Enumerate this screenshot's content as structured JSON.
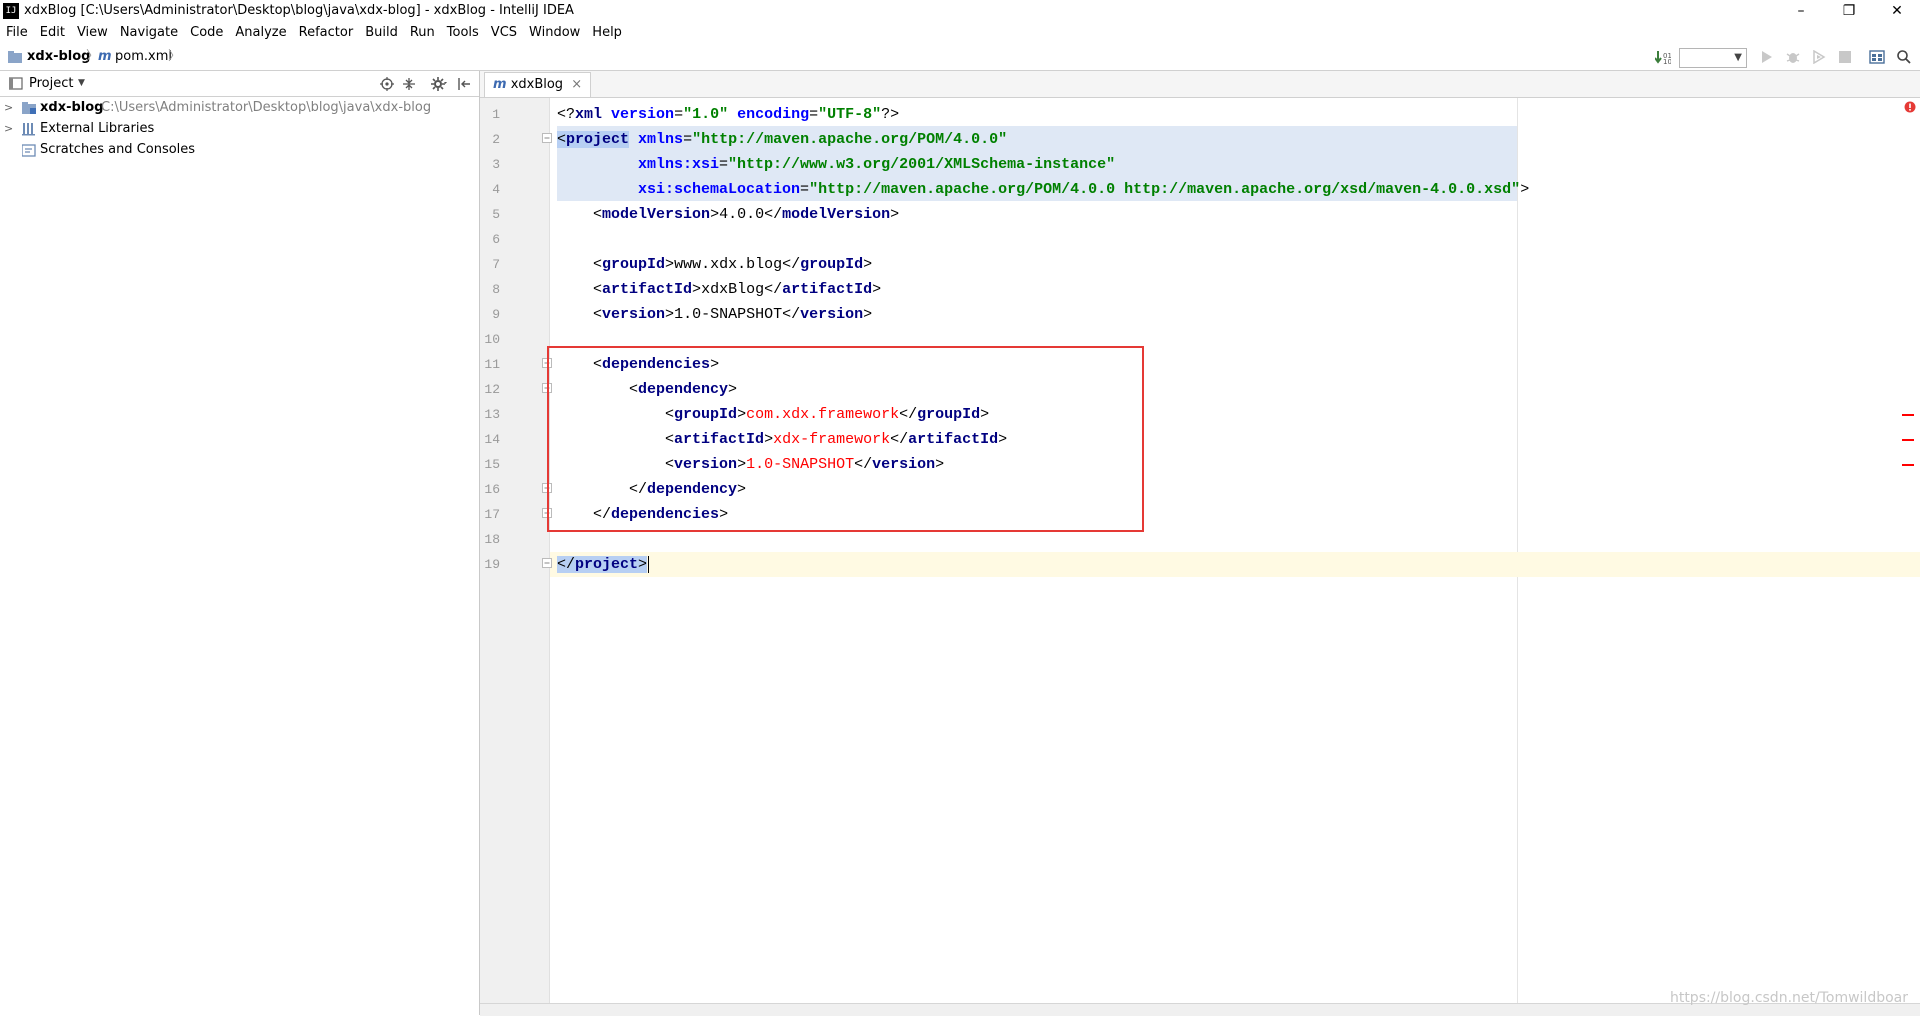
{
  "window": {
    "title": "xdxBlog [C:\\Users\\Administrator\\Desktop\\blog\\java\\xdx-blog] - xdxBlog - IntelliJ IDEA",
    "minimize": "–",
    "restore": "❐",
    "close": "✕"
  },
  "menu": [
    "File",
    "Edit",
    "View",
    "Navigate",
    "Code",
    "Analyze",
    "Refactor",
    "Build",
    "Run",
    "Tools",
    "VCS",
    "Window",
    "Help"
  ],
  "navbar": {
    "project": "xdx-blog",
    "file_icon": "m",
    "file": "pom.xml"
  },
  "project_panel": {
    "header": "Project",
    "tree": [
      {
        "name": "xdx-blog",
        "path": "C:\\Users\\Administrator\\Desktop\\blog\\java\\xdx-blog"
      },
      {
        "name": "External Libraries",
        "path": ""
      },
      {
        "name": "Scratches and Consoles",
        "path": ""
      }
    ]
  },
  "tab": {
    "icon": "m",
    "label": "xdxBlog",
    "close": "×"
  },
  "editor": {
    "line_numbers": [
      "1",
      "2",
      "3",
      "4",
      "5",
      "6",
      "7",
      "8",
      "9",
      "10",
      "11",
      "12",
      "13",
      "14",
      "15",
      "16",
      "17",
      "18",
      "19"
    ],
    "tokens": {
      "l1_open": "<?",
      "l1_tag": "xml",
      "l1_a1": "version",
      "l1_eq1": "=",
      "l1_v1": "\"1.0\"",
      "l1_a2": "encoding",
      "l1_eq2": "=",
      "l1_v2": "\"UTF-8\"",
      "l1_close": "?>",
      "l2_lt": "<",
      "l2_tag": "project",
      "l2_a1": "xmlns",
      "l2_eq1": "=",
      "l2_v1": "\"http://maven.apache.org/POM/4.0.0\"",
      "l3_a1": "xmlns:xsi",
      "l3_eq1": "=",
      "l3_v1": "\"http://www.w3.org/2001/XMLSchema-instance\"",
      "l4_a1": "xsi:schemaLocation",
      "l4_eq1": "=",
      "l4_v1": "\"http://maven.apache.org/POM/4.0.0 http://maven.apache.org/xsd/maven-4.0.0.xsd\"",
      "l4_gt": ">",
      "lt": "<",
      "gt": ">",
      "lts": "</",
      "modelVersion": "modelVersion",
      "modelVersion_val": "4.0.0",
      "groupId": "groupId",
      "groupId_val": "www.xdx.blog",
      "artifactId": "artifactId",
      "artifactId_val": "xdxBlog",
      "version": "version",
      "version_val": "1.0-SNAPSHOT",
      "dependencies": "dependencies",
      "dependency": "dependency",
      "dep_groupId_val": "com.xdx.framework",
      "dep_artifactId_val": "xdx-framework",
      "dep_version_val": "1.0-SNAPSHOT",
      "project": "project"
    }
  },
  "watermark": "https://blog.csdn.net/Tomwildboar",
  "colors": {
    "tag": "#000080",
    "attribute": "#0000ff",
    "string": "#008000",
    "error": "#ff0000",
    "highlight_box": "#e53935"
  }
}
